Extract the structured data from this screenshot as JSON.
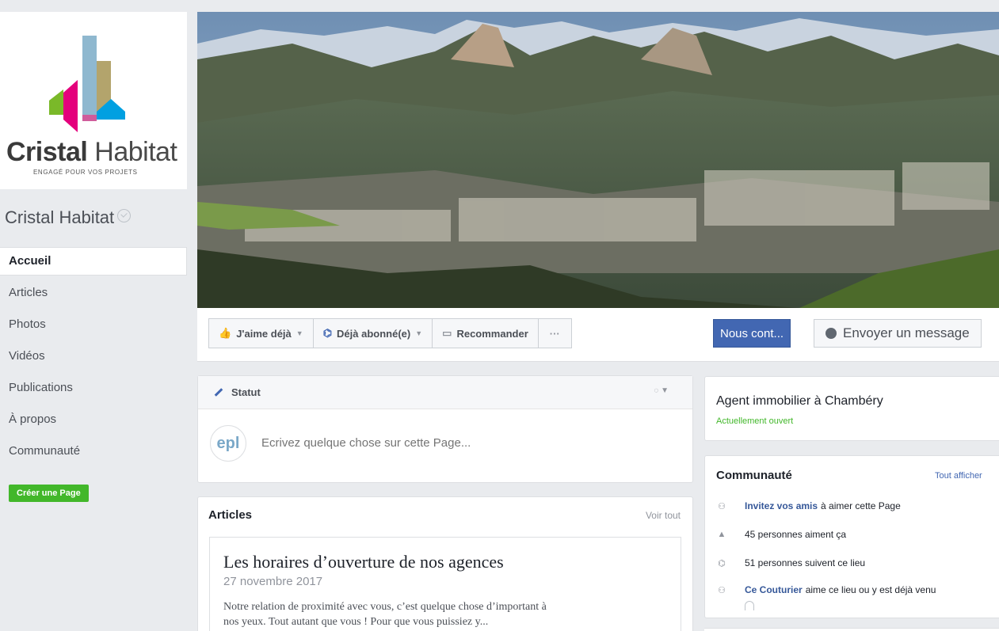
{
  "brand": {
    "logo_name_bold": "Cristal",
    "logo_name_rest": " Habitat",
    "logo_tagline": "ENGAGÉ POUR VOS PROJETS",
    "page_name": "Cristal Habitat",
    "logo_colors": [
      "#e4007c",
      "#00a0e1",
      "#b3a46c",
      "#7ab929"
    ]
  },
  "nav": {
    "items": [
      "Accueil",
      "Articles",
      "Photos",
      "Vidéos",
      "Publications",
      "À propos",
      "Communauté"
    ],
    "active": "Accueil",
    "create_page": "Créer une Page"
  },
  "actions": {
    "like": "J'aime déjà",
    "follow": "Déjà abonné(e)",
    "recommend": "Recommander",
    "more": "···",
    "contact": "Nous cont...",
    "message": "Envoyer un message"
  },
  "composer": {
    "tab": "Statut",
    "avatar_text": "epl",
    "placeholder": "Ecrivez quelque chose sur cette Page..."
  },
  "articles": {
    "title": "Articles",
    "see_all": "Voir tout",
    "item": {
      "title": "Les horaires d’ouverture de nos agences",
      "date": "27 novembre 2017",
      "excerpt_1": "Notre relation de proximité avec vous, c’est quelque chose d’important à",
      "excerpt_2": "nos yeux. Tout autant que vous ! Pour que vous puissiez y..."
    }
  },
  "info": {
    "category": "Agent immobilier à Chambéry",
    "open_status": "Actuellement ouvert"
  },
  "community": {
    "title": "Communauté",
    "see_all": "Tout afficher",
    "invite_link": "Invitez vos amis",
    "invite_rest": "à aimer cette Page",
    "likes": "45 personnes aiment ça",
    "follows": "51 personnes suivent ce lieu",
    "friend_link": "Ce Couturier",
    "friend_rest": "aime ce lieu ou y est déjà venu"
  },
  "colors": {
    "fb_blue": "#4267b2",
    "link": "#365899",
    "green": "#42b72a",
    "background": "#e9ebee"
  }
}
